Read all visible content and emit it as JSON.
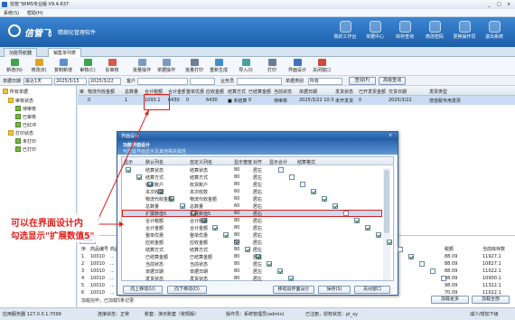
{
  "window": {
    "title": "信管飞RMS专业版 V9.4.637",
    "controls": [
      "_",
      "□",
      "×"
    ]
  },
  "menu": [
    "系统(S)",
    "帮助(H)"
  ],
  "brand": {
    "logo": "信管飞",
    "tagline": "精细化管理软件"
  },
  "nav": [
    "我的工作台",
    "单据中心",
    "库存查询",
    "修改密码",
    "更换操作员",
    "退出系统"
  ],
  "tabs": [
    "功能导航器",
    "销售单列表"
  ],
  "toolbar": [
    "新增(N)",
    "修改(E)",
    "复制新增",
    "审核(C)",
    "反审核",
    "批量操作",
    "单据操作",
    "批量打印",
    "重新生成",
    "导入(I)",
    "打印",
    "界面设计",
    "关闭窗口"
  ],
  "filters": {
    "date_label": "单据日期",
    "date_preset": "最近1天",
    "date_from": "2025/3/15",
    "date_to": "2025/3/22",
    "customer_label": "客户",
    "salesman_label": "业务员",
    "status_label": "单据类别",
    "status_value": "所有",
    "query_button": "查询(F)",
    "advanced_button": "高级查询"
  },
  "tree": {
    "root": "所有单据",
    "groups": [
      {
        "label": "审核状态",
        "children": [
          "待审核",
          "已审核",
          "已红冲"
        ]
      },
      {
        "label": "打印状态",
        "children": [
          "未打印",
          "已打印"
        ]
      }
    ]
  },
  "grid": {
    "headers": [
      "审",
      "物流代收金额",
      "总数量",
      "合计税额",
      "合计金额",
      "整单优惠",
      "应收金额",
      "结算方式",
      "已结算金额",
      "当前状态",
      "单据日期",
      "发货状态",
      "已开发票金额",
      "交货日期",
      "发票类型"
    ],
    "rows": [
      [
        "",
        "0",
        "1",
        "1093.1",
        "6430",
        "0",
        "6430",
        "■ 未结算",
        "0",
        "待审核",
        "2025/3/22 10:38",
        "未开发货",
        "0",
        "2025/3/22",
        "增值税专用发票"
      ]
    ]
  },
  "detail": {
    "tab": "明细",
    "headers": [
      "序",
      "商品编号",
      "商品名称"
    ],
    "rows": [
      [
        "1",
        "10010",
        "..."
      ],
      [
        "2",
        "10010",
        "..."
      ],
      [
        "3",
        "10010",
        "..."
      ],
      [
        "4",
        "10010",
        "..."
      ],
      [
        "5",
        "10010",
        "..."
      ],
      [
        "6",
        "10010",
        "..."
      ]
    ],
    "right_headers": [
      "税额",
      "当前库存数"
    ],
    "right_rows": [
      [
        "88.09",
        "11927.1"
      ],
      [
        "88.09",
        "10827.1"
      ],
      [
        "88.09",
        "11022.1"
      ],
      [
        "88.09",
        "10900.1"
      ],
      [
        "98.09",
        "11322.1"
      ],
      [
        "70.09",
        "11022.1"
      ]
    ],
    "footer": "加载完毕，已加载5条记录",
    "load_more": "加载更多",
    "load_all": "加载全部"
  },
  "statusbar": {
    "server": "应用服务器 127.0.0.1:7099",
    "db": "连接状态：正常",
    "account": "账套：演示账套（常规版）",
    "operator": "操作员：系统管理员(admin)",
    "version": "已注册，授权状态：pl_xy",
    "right": "减少/增加下级"
  },
  "dialog": {
    "title": "界面设计",
    "subtitle": "功能界面设计",
    "hint": "可配置界面显示及其他相关属性",
    "headers": [
      "显示",
      "默认列名",
      "自定义列名",
      "显示宽度",
      "对齐",
      "显示合计",
      "结算格式"
    ],
    "rows": [
      [
        "on",
        "结算状态",
        "结算状态",
        "80",
        "居左",
        "off"
      ],
      [
        "on",
        "结算方式",
        "结算方式",
        "80",
        "居左",
        "off"
      ],
      [
        "on",
        "收货账户",
        "收货账户",
        "80",
        "居左",
        "off"
      ],
      [
        "on",
        "本次收款",
        "本次收款",
        "60",
        "居右",
        "on"
      ],
      [
        "on",
        "物流代收金额",
        "物流代收金额",
        "60",
        "居右",
        "on"
      ],
      [
        "on",
        "总数量",
        "总数量",
        "60",
        "居右",
        "on"
      ],
      [
        "on",
        "扩展数值5",
        "扩展数值5",
        "60",
        "居右",
        "off"
      ],
      [
        "on",
        "合计税额",
        "合计税额",
        "80",
        "居右",
        "on"
      ],
      [
        "on",
        "合计金额",
        "合计金额",
        "80",
        "居右",
        "on"
      ],
      [
        "on",
        "整单优惠",
        "整单优惠",
        "80",
        "居右",
        "on"
      ],
      [
        "on",
        "应收金额",
        "应收金额",
        "80",
        "居右",
        "on"
      ],
      [
        "on",
        "结算方式",
        "结算方式",
        "80",
        "居左",
        "off"
      ],
      [
        "on",
        "已结算金额",
        "已结算金额",
        "80",
        "居右",
        "on"
      ],
      [
        "on",
        "当前状态",
        "当前状态",
        "80",
        "居左",
        "off"
      ],
      [
        "on",
        "单据日期",
        "单据日期",
        "80",
        "居左",
        "off"
      ],
      [
        "on",
        "发货状态",
        "发货状态",
        "80",
        "居左",
        "off"
      ]
    ],
    "buttons": [
      "向上移动(U)",
      "向下移动(D)",
      "移动调界面设计",
      "保存(S)",
      "关闭窗口"
    ]
  },
  "annotation": {
    "line1": "可以在界面设计内",
    "line2": "勾选显示\"扩展数值5\""
  },
  "colors": {
    "banner": "#2a74c2",
    "annotation": "#e0201b",
    "selected_row": "#c9dcf3"
  }
}
